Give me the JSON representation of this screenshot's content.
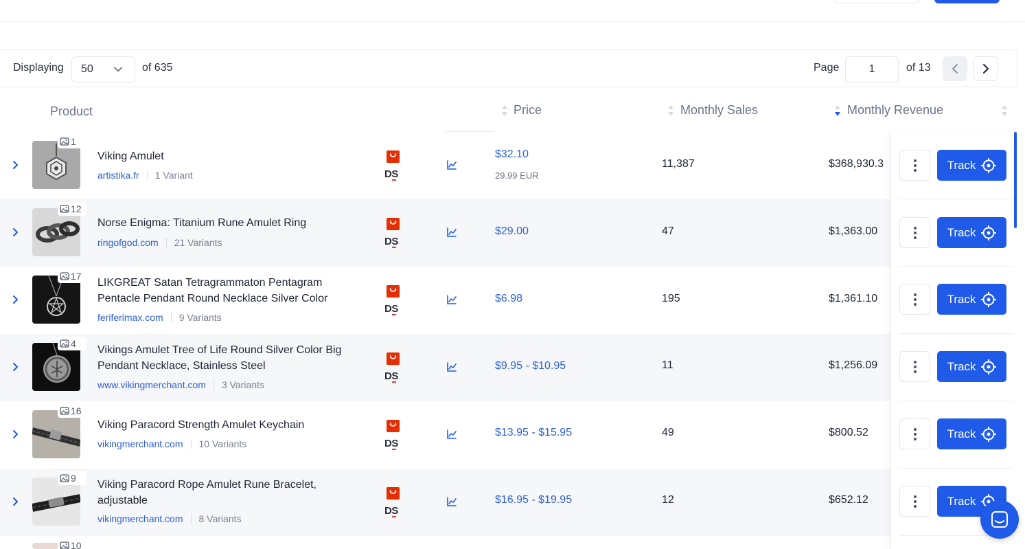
{
  "toolbar": {
    "displaying_label": "Displaying",
    "per_page": "50",
    "of_total": "of 635",
    "page_label": "Page",
    "page_value": "1",
    "of_pages": "of 13"
  },
  "columns": {
    "product": "Product",
    "price": "Price",
    "monthly_sales": "Monthly Sales",
    "monthly_revenue": "Monthly Revenue"
  },
  "actions": {
    "track_label": "Track"
  },
  "colors": {
    "accent": "#1f5be8",
    "link": "#2e5fd8",
    "aliexpress": "#e62e04"
  },
  "rows": [
    {
      "image_count": "1",
      "name": "Viking Amulet",
      "store": "artistika.fr",
      "variants": "1 Variant",
      "price": "$32.10",
      "price_sub": "29.99 EUR",
      "sales": "11,387",
      "revenue": "$368,930.3"
    },
    {
      "image_count": "12",
      "name": "Norse Enigma: Titanium Rune Amulet Ring",
      "store": "ringofgod.com",
      "variants": "21 Variants",
      "price": "$29.00",
      "price_sub": "",
      "sales": "47",
      "revenue": "$1,363.00"
    },
    {
      "image_count": "17",
      "name": "LIKGREAT Satan Tetragrammaton Pentagram Pentacle Pendant Round Necklace Silver Color",
      "store": "feriferimax.com",
      "variants": "9 Variants",
      "price": "$6.98",
      "price_sub": "",
      "sales": "195",
      "revenue": "$1,361.10"
    },
    {
      "image_count": "4",
      "name": "Vikings Amulet Tree of Life Round Silver Color Big Pendant Necklace, Stainless Steel",
      "store": "www.vikingmerchant.com",
      "variants": "3 Variants",
      "price": "$9.95 - $10.95",
      "price_sub": "",
      "sales": "11",
      "revenue": "$1,256.09"
    },
    {
      "image_count": "16",
      "name": "Viking Paracord Strength Amulet Keychain",
      "store": "vikingmerchant.com",
      "variants": "10 Variants",
      "price": "$13.95 - $15.95",
      "price_sub": "",
      "sales": "49",
      "revenue": "$800.52"
    },
    {
      "image_count": "9",
      "name": "Viking Paracord Rope Amulet Rune Bracelet, adjustable",
      "store": "vikingmerchant.com",
      "variants": "8 Variants",
      "price": "$16.95 - $19.95",
      "price_sub": "",
      "sales": "12",
      "revenue": "$652.12"
    },
    {
      "image_count": "10",
      "name": "",
      "store": "",
      "variants": "",
      "price": "",
      "price_sub": "",
      "sales": "",
      "revenue": ""
    }
  ]
}
